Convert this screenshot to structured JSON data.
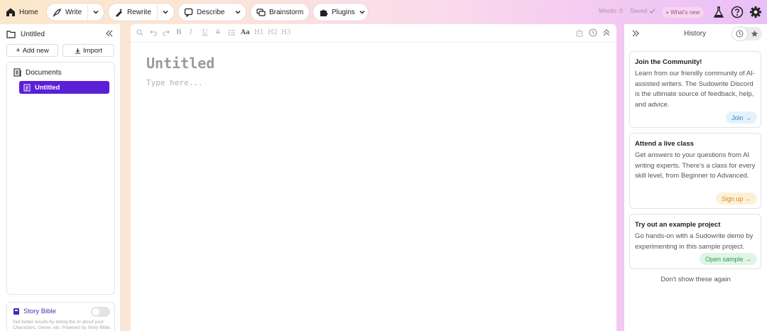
{
  "topbar": {
    "home": "Home",
    "write": "Write",
    "rewrite": "Rewrite",
    "describe": "Describe",
    "brainstorm": "Brainstorm",
    "plugins": "Plugins",
    "words": "Words: 0",
    "saved": "Saved",
    "whats_new": "What's new"
  },
  "left": {
    "title": "Untitled",
    "add_new": "Add new",
    "import": "Import",
    "documents_label": "Documents",
    "documents": [
      {
        "label": "Untitled",
        "selected": true
      }
    ],
    "story_bible": {
      "title": "Story Bible",
      "enabled": false,
      "description": "Get better results by telling the AI about your Characters, Genre, etc. Powered by Story Bible."
    }
  },
  "editor": {
    "title_placeholder": "Untitled",
    "body_placeholder": "Type here...",
    "toolbar": [
      "B",
      "I",
      "U",
      "S",
      "Aa",
      "H1",
      "H2",
      "H3"
    ]
  },
  "right": {
    "title": "History",
    "cards": [
      {
        "title": "Join the Community!",
        "body": "Learn from our friendly community of AI-assisted writers. The Sudowrite Discord is the ultimate source of feedback, help, and advice.",
        "button": "Join →",
        "color": "#e3f2fb",
        "text_color": "#2b86c4"
      },
      {
        "title": "Attend a live class",
        "body": "Get answers to your questions from AI writing experts. There's a class for every skill level, from Beginner to Advanced.",
        "button": "Sign up →",
        "color": "#fdf0d8",
        "text_color": "#d98a1a"
      },
      {
        "title": "Try out an example project",
        "body": "Go hands-on with a Sudowrite demo by experimenting in this sample project.",
        "button": "Open sample →",
        "color": "#dff5e6",
        "text_color": "#2f9b55"
      }
    ],
    "dont_show": "Don't show these again"
  },
  "colors": {
    "accent": "#5b1fd6",
    "story_bible": "#4a2bb0"
  }
}
